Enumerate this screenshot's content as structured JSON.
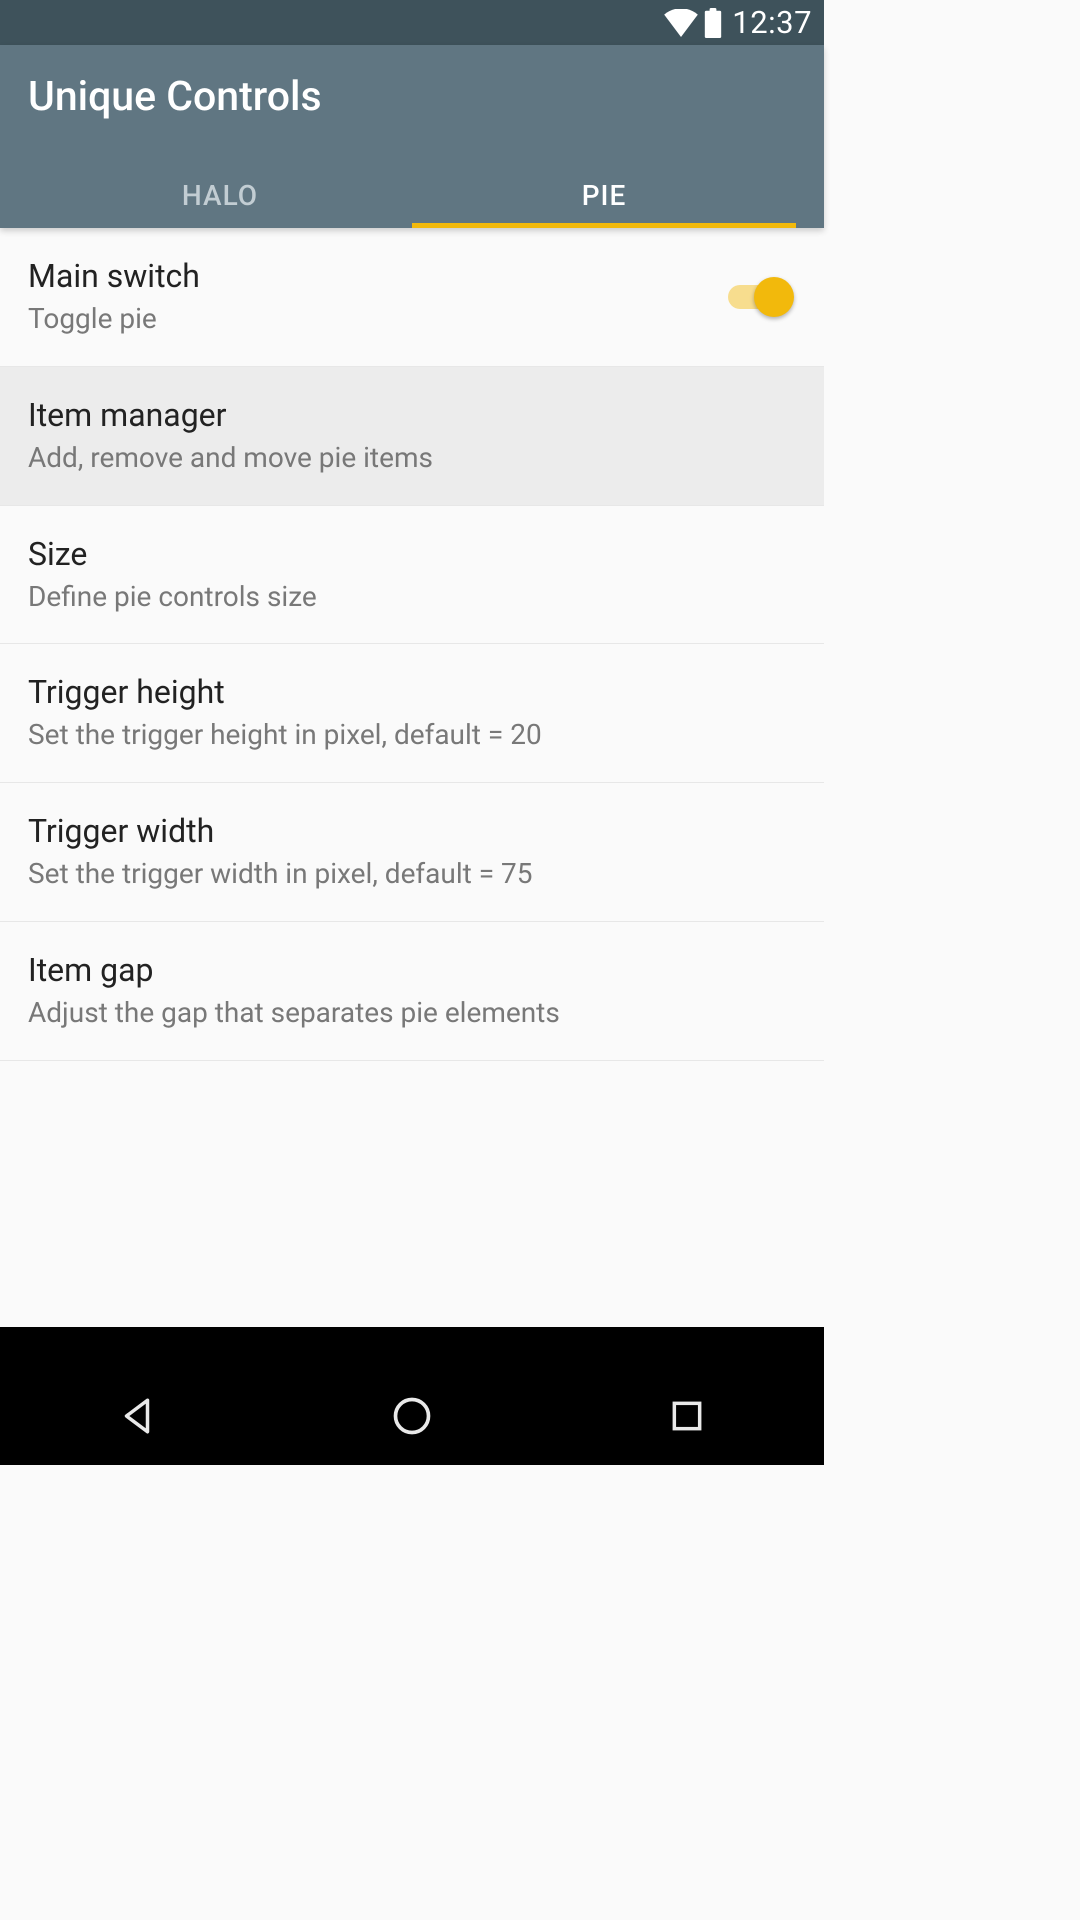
{
  "status": {
    "time": "12:37",
    "wifi_icon": "wifi-icon",
    "battery_icon": "battery-icon"
  },
  "header": {
    "title": "Unique Controls",
    "tabs": [
      {
        "label": "HALO",
        "active": false
      },
      {
        "label": "PIE",
        "active": true
      }
    ]
  },
  "colors": {
    "accent": "#f2b90c",
    "header_bg": "#607682",
    "status_bg": "#3e525b"
  },
  "settings": [
    {
      "id": "main-switch",
      "title": "Main switch",
      "subtitle": "Toggle pie",
      "has_switch": true,
      "switch_on": true,
      "highlight": false
    },
    {
      "id": "item-manager",
      "title": "Item manager",
      "subtitle": "Add, remove and move pie items",
      "has_switch": false,
      "highlight": true
    },
    {
      "id": "size",
      "title": "Size",
      "subtitle": "Define pie controls size",
      "has_switch": false,
      "highlight": false
    },
    {
      "id": "trigger-height",
      "title": "Trigger height",
      "subtitle": "Set the trigger height in pixel, default = 20",
      "has_switch": false,
      "highlight": false
    },
    {
      "id": "trigger-width",
      "title": "Trigger width",
      "subtitle": "Set the trigger width in pixel, default = 75",
      "has_switch": false,
      "highlight": false
    },
    {
      "id": "item-gap",
      "title": "Item gap",
      "subtitle": "Adjust the gap that separates pie elements",
      "has_switch": false,
      "highlight": false
    }
  ],
  "navbar": {
    "back": "back",
    "home": "home",
    "recents": "recents"
  }
}
